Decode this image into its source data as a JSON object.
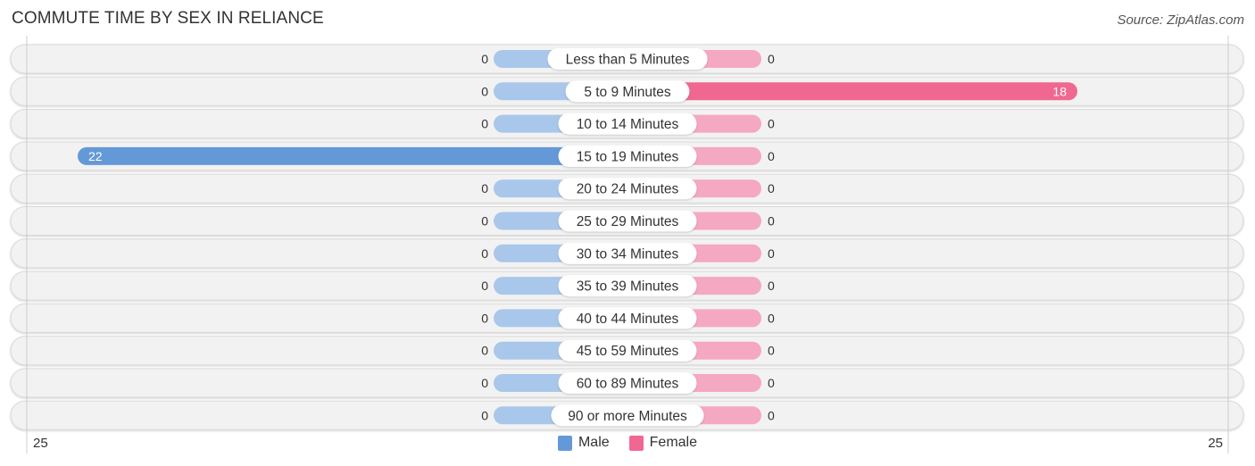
{
  "header": {
    "title": "COMMUTE TIME BY SEX IN RELIANCE",
    "source": "Source: ZipAtlas.com"
  },
  "colors": {
    "male_strong": "#6499d8",
    "male_light": "#a9c7ea",
    "female_strong": "#f06892",
    "female_light": "#f5a8c1",
    "row_bg": "#f2f2f2",
    "row_border": "#d9d9d9",
    "axis": "#cccccc"
  },
  "chart_data": {
    "type": "bar",
    "orientation": "horizontal-diverging",
    "title": "COMMUTE TIME BY SEX IN RELIANCE",
    "categories": [
      "Less than 5 Minutes",
      "5 to 9 Minutes",
      "10 to 14 Minutes",
      "15 to 19 Minutes",
      "20 to 24 Minutes",
      "25 to 29 Minutes",
      "30 to 34 Minutes",
      "35 to 39 Minutes",
      "40 to 44 Minutes",
      "45 to 59 Minutes",
      "60 to 89 Minutes",
      "90 or more Minutes"
    ],
    "series": [
      {
        "name": "Male",
        "values": [
          0,
          0,
          0,
          22,
          0,
          0,
          0,
          0,
          0,
          0,
          0,
          0
        ]
      },
      {
        "name": "Female",
        "values": [
          0,
          18,
          0,
          0,
          0,
          0,
          0,
          0,
          0,
          0,
          0,
          0
        ]
      }
    ],
    "xlim": [
      -25,
      25
    ],
    "axis_tick_labels": {
      "left": "25",
      "right": "25"
    },
    "legend": {
      "position": "bottom-center",
      "entries": [
        "Male",
        "Female"
      ]
    },
    "grid": false
  }
}
